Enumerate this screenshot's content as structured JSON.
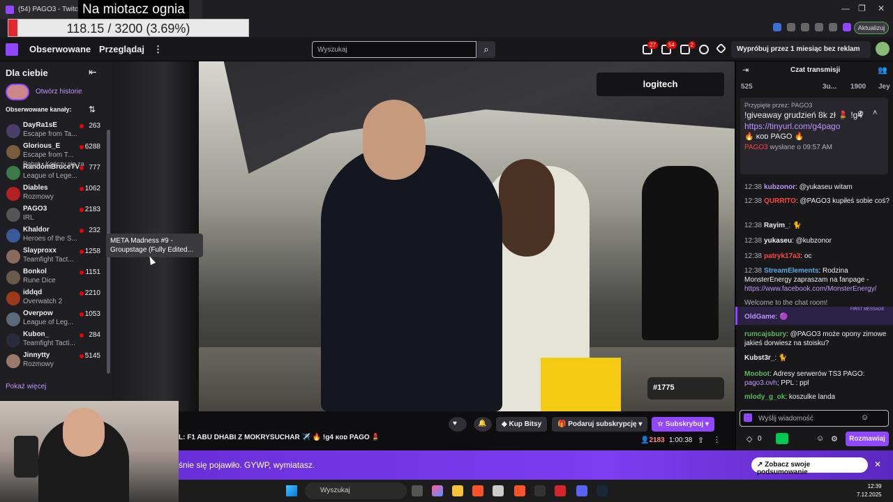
{
  "browser": {
    "tab_title": "(54) PAGO3 - Twitch",
    "overlay_title": "Na miotacz ognia",
    "progress_text": "118.15 / 3200 (3.69%)",
    "progress_fraction": 0.0369,
    "update_label": "Aktualizuj"
  },
  "nav": {
    "following": "Obserwowane",
    "browse": "Przeglądaj",
    "more": "⋮",
    "search_placeholder": "Wyszukaj",
    "badges": {
      "inbox": "27",
      "whispers": "54",
      "notifications": "2"
    },
    "promo": "Wypróbuj przez 1 miesiąc bez reklam"
  },
  "sidebar": {
    "for_you": "Dla ciebie",
    "stories": "Otwórz historie",
    "followed_header": "Obserwowane kanały:",
    "extra_line": "Rabat • Kończy się za",
    "show_more": "Pokaż więcej",
    "channels": [
      {
        "name": "DayRa1sE",
        "game": "Escape from Ta...",
        "viewers": "263",
        "color": "#4a3f6b"
      },
      {
        "name": "Glorious_E",
        "game": "Escape from T...",
        "viewers": "6288",
        "color": "#7a5c3a"
      },
      {
        "name": "RandomBruceTV",
        "game": "League of Lege...",
        "viewers": "777",
        "color": "#3c7a4a"
      },
      {
        "name": "Diables",
        "game": "Rozmowy",
        "viewers": "1062",
        "color": "#b52020"
      },
      {
        "name": "PAGO3",
        "game": "IRL",
        "viewers": "2183",
        "color": "#555"
      },
      {
        "name": "Khaldor",
        "game": "Heroes of the S...",
        "viewers": "232",
        "color": "#3a5a9a"
      },
      {
        "name": "Slayproxx",
        "game": "Teamfight Tact...",
        "viewers": "1258",
        "color": "#8a6a5a"
      },
      {
        "name": "Bonkol",
        "game": "Rune Dice",
        "viewers": "1151",
        "color": "#6a5a4a"
      },
      {
        "name": "iddqd",
        "game": "Overwatch 2",
        "viewers": "2210",
        "color": "#9a3a1a"
      },
      {
        "name": "Overpow",
        "game": "League of Leg...",
        "viewers": "1053",
        "color": "#5a6a7a"
      },
      {
        "name": "Kubon_",
        "game": "Teamfight Tacti...",
        "viewers": "284",
        "color": "#2a2a3a"
      },
      {
        "name": "Jinnytty",
        "game": "Rozmowy",
        "viewers": "5145",
        "color": "#9a7a6a"
      }
    ]
  },
  "video": {
    "tooltip": "META Madness #9 - Groupstage (Fully Edited...",
    "sponsor": "logitech",
    "race_number": "#1775"
  },
  "stream": {
    "title": "L: F1 ABU DHABI Z MOKRYSUCHAR ✈️ 🔥 !g4 ᴋᴏᴅ PAGO 💄",
    "viewers": "2183",
    "uptime": "1:00:38",
    "buttons": {
      "bits": "Kup Bitsy",
      "gift": "Podaruj subskrypcję",
      "subscribe": "Subskrybuj"
    }
  },
  "banner": {
    "text": "śnie się pojawiło. GYWP, wymiatasz.",
    "recap": "Zobacz swoje podsumowanie"
  },
  "chat": {
    "title": "Czat transmisji",
    "leaderboard": {
      "count": "525",
      "top1": "3u...",
      "top2": "1900",
      "top3": "Jey"
    },
    "pinned": {
      "by": "Przypięte przez: PAGO3",
      "message": "!giveaway grudzień 8k zł 💄 !g4",
      "link": "https://tinyurl.com/g4pago",
      "code": "🔥 ᴋᴏᴅ PAGO 🔥",
      "sent_user": "PAGO3",
      "sent": "wysłane o 09:57 AM"
    },
    "messages": [
      {
        "time": "12:38",
        "user": "kubzonor",
        "color": "#bf94ff",
        "text": "@yukaseu witam"
      },
      {
        "time": "12:38",
        "user": "QURRITO",
        "color": "#ff4040",
        "text": "@PAGO3 kupiłeś sobie coś?"
      },
      {
        "time": "12:38",
        "user": "Rayim_",
        "color": "#efeff1",
        "text": "🐈"
      },
      {
        "time": "12:38",
        "user": "yukaseu",
        "color": "#efeff1",
        "text": "@kubzonor"
      },
      {
        "time": "12:38",
        "user": "patryk17a3",
        "color": "#ff4040",
        "text": "oc"
      },
      {
        "time": "12:38",
        "user": "StreamElements",
        "color": "#5aa9e6",
        "text": "Rodzina MonsterEnergy zapraszam na fanpage -",
        "link": "https://www.facebook.com/MonsterEnergy/"
      },
      {
        "time": "",
        "user": "",
        "color": "#adadb8",
        "text": "Welcome to the chat room!"
      },
      {
        "time": "",
        "user": "OldGame",
        "color": "#bf94ff",
        "text": "🟣"
      },
      {
        "time": "",
        "user": "rumcajsbury",
        "color": "#5ab85a",
        "text": "@PAGO3 może opony zimowe jakieś dorwiesz na stoisku?"
      },
      {
        "time": "",
        "user": "Kubst3r_",
        "color": "#efeff1",
        "text": "🐈"
      },
      {
        "time": "",
        "user": "Moobot",
        "color": "#5ab85a",
        "text": "Adresy serwerów TS3 PAGO:",
        "link": "pago3.ovh",
        "extra": "; PPL : ppl"
      },
      {
        "time": "",
        "user": "mlody_g_ok",
        "color": "#5ab85a",
        "text": "koszulke landa"
      }
    ],
    "first_message_label": "FIRST MESSAGE",
    "input_placeholder": "Wyślij wiadomość",
    "points": "0",
    "chat_button": "Rozmawiaj"
  },
  "taskbar": {
    "search": "Wyszukaj",
    "time": "12:39",
    "date": "7.12.2025"
  }
}
